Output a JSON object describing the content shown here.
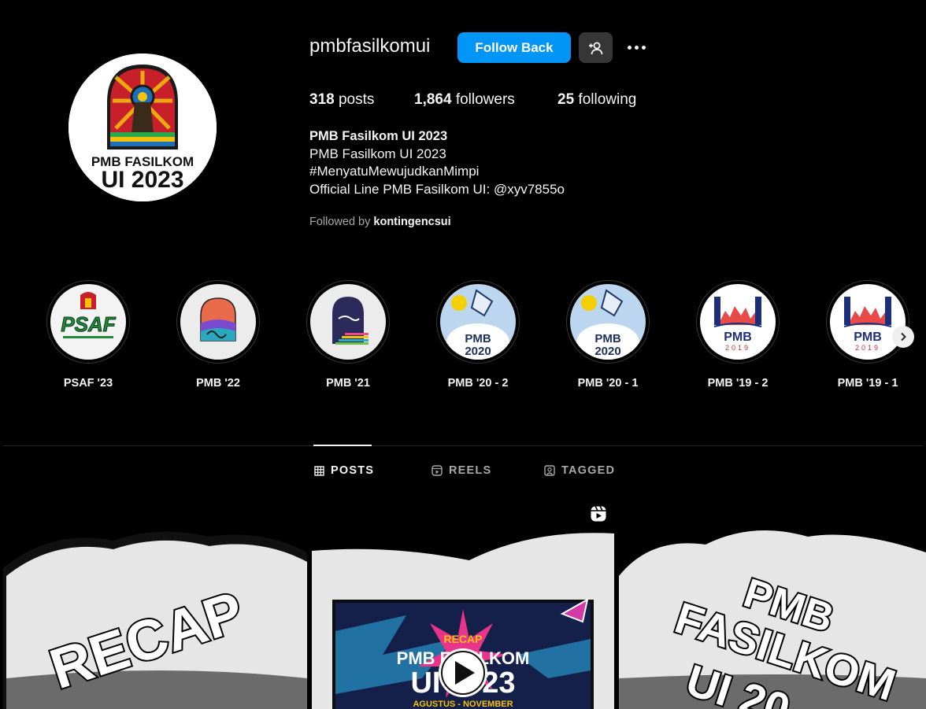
{
  "profile": {
    "username": "pmbfasilkomui",
    "follow_back_label": "Follow Back",
    "avatar_text_top": "PMB FASILKOM",
    "avatar_text_bottom": "UI 2023"
  },
  "stats": {
    "posts_count": "318",
    "posts_label": "posts",
    "followers_count": "1,864",
    "followers_label": "followers",
    "following_count": "25",
    "following_label": "following"
  },
  "bio": {
    "name": "PMB Fasilkom UI 2023",
    "lines": [
      "PMB Fasilkom UI 2023",
      "#MenyatuMewujudkanMimpi",
      "Official Line PMB Fasilkom UI: @xyv7855o"
    ],
    "followed_by_prefix": "Followed by",
    "followed_by_user": "kontingencsui"
  },
  "highlights": [
    {
      "label": "PSAF '23",
      "badge": "PSAF"
    },
    {
      "label": "PMB '22",
      "badge": ""
    },
    {
      "label": "PMB '21",
      "badge": ""
    },
    {
      "label": "PMB '20 - 2",
      "badge": "PMB 2020"
    },
    {
      "label": "PMB '20 - 1",
      "badge": "PMB 2020"
    },
    {
      "label": "PMB '19 - 2",
      "badge": "PMB 2019"
    },
    {
      "label": "PMB '19 - 1",
      "badge": "PMB 2019"
    }
  ],
  "tabs": [
    {
      "label": "POSTS",
      "active": true
    },
    {
      "label": "REELS",
      "active": false
    },
    {
      "label": "TAGGED",
      "active": false
    }
  ],
  "posts": [
    {
      "text": "RECAP"
    },
    {
      "text_top": "RECAP",
      "text_mid": "PMB FASILKOM",
      "text_big": "UI 2023",
      "text_sub": "AGUSTUS - NOVEMBER"
    },
    {
      "text_l1": "PMB",
      "text_l2": "FASILKOM",
      "text_l3": "UI 20"
    }
  ],
  "colors": {
    "accent_blue": "#0095f6",
    "secondary_button": "#363636",
    "muted_text": "#a8a8a8",
    "background": "#000000"
  }
}
